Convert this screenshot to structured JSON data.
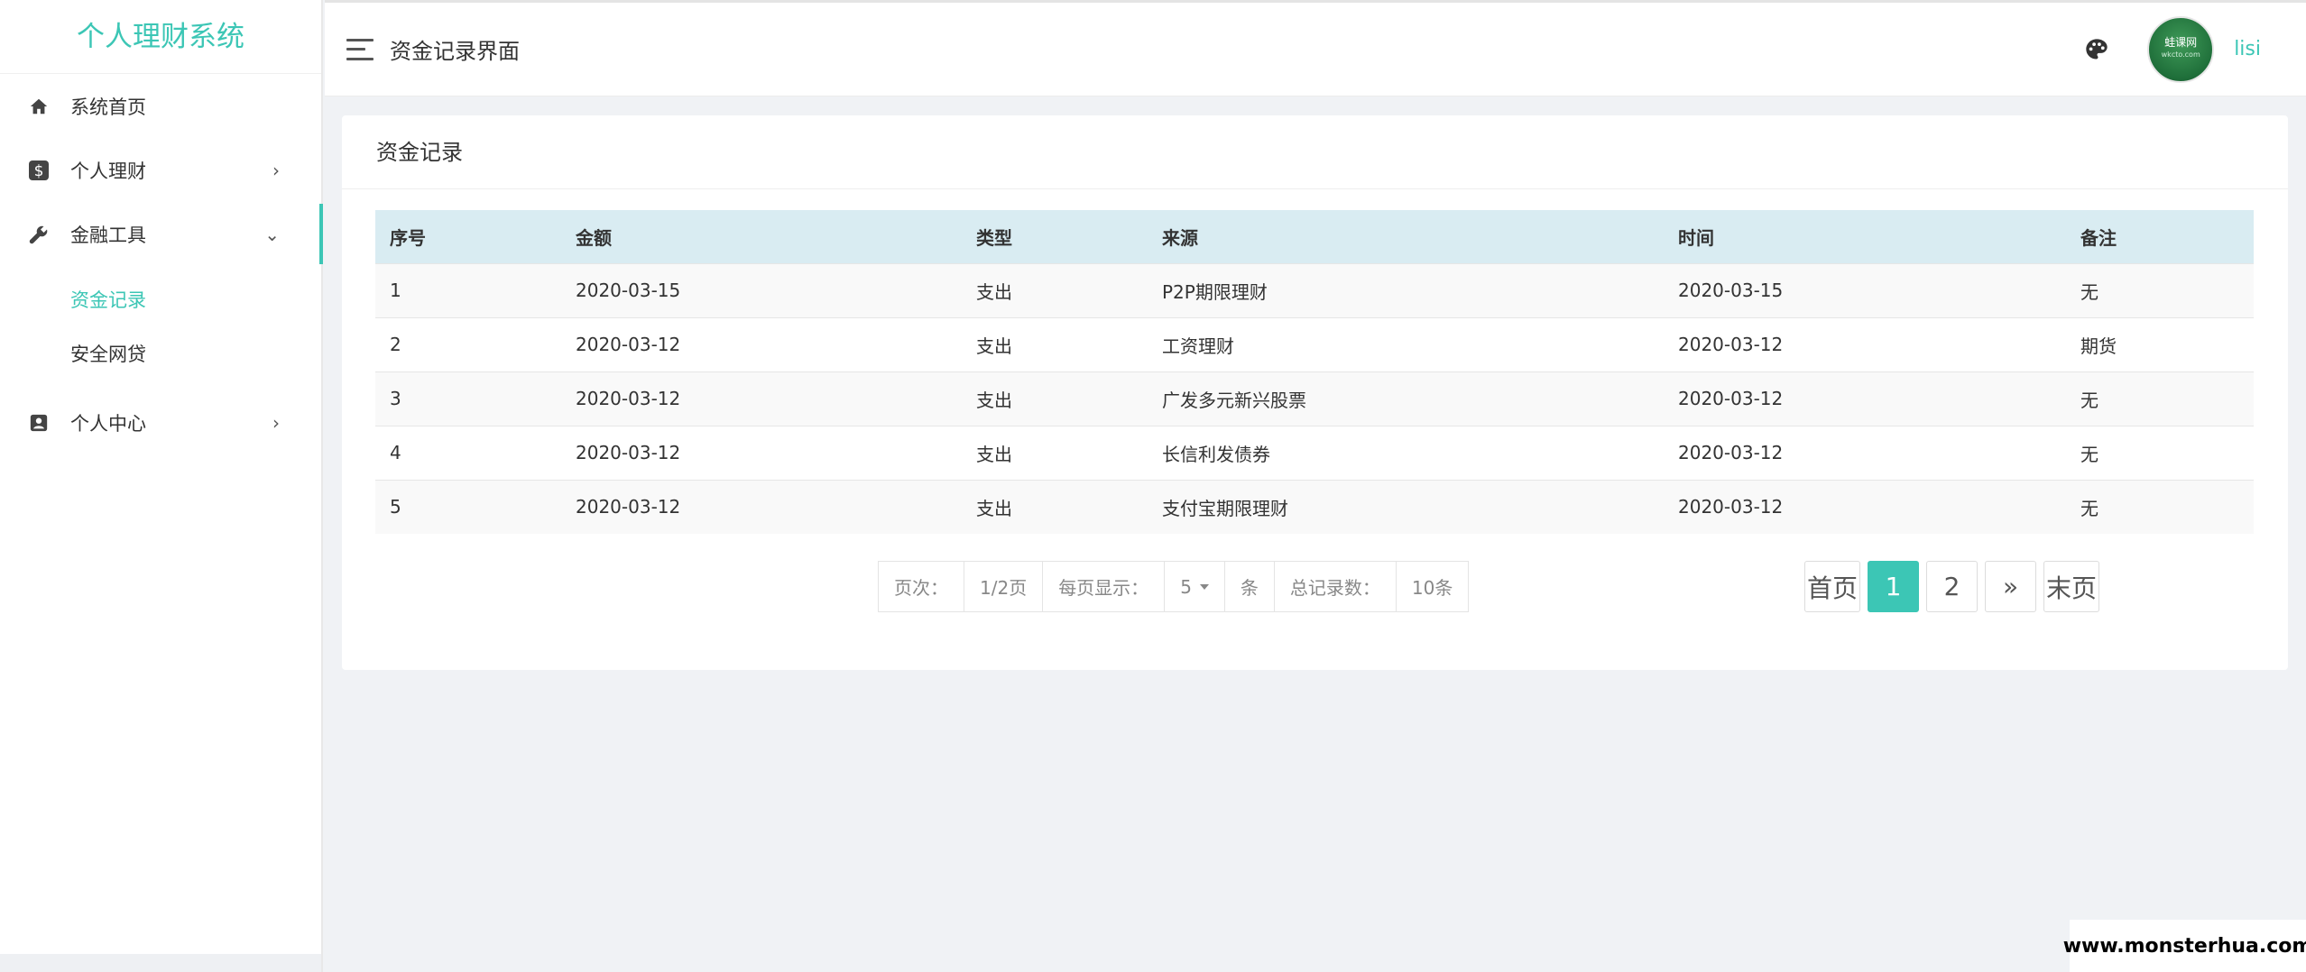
{
  "brand": {
    "title": "个人理财系统"
  },
  "sidebar": {
    "items": [
      {
        "label": "系统首页",
        "icon": "home-icon"
      },
      {
        "label": "个人理财",
        "icon": "dollar-icon",
        "arrow": "›"
      },
      {
        "label": "金融工具",
        "icon": "wrench-icon",
        "arrow": "⌄",
        "active": true,
        "children": [
          {
            "label": "资金记录",
            "active": true
          },
          {
            "label": "安全网贷"
          }
        ]
      },
      {
        "label": "个人中心",
        "icon": "user-card-icon",
        "arrow": "›"
      }
    ]
  },
  "header": {
    "page_title": "资金记录界面",
    "username": "lisi",
    "avatar_text": "蛙课网",
    "avatar_sub": "wkcto.com"
  },
  "card": {
    "title": "资金记录",
    "table": {
      "columns": [
        "序号",
        "金额",
        "类型",
        "来源",
        "时间",
        "备注"
      ],
      "rows": [
        [
          "1",
          "2020-03-15",
          "支出",
          "P2P期限理财",
          "2020-03-15",
          "无"
        ],
        [
          "2",
          "2020-03-12",
          "支出",
          "工资理财",
          "2020-03-12",
          "期货"
        ],
        [
          "3",
          "2020-03-12",
          "支出",
          "广发多元新兴股票",
          "2020-03-12",
          "无"
        ],
        [
          "4",
          "2020-03-12",
          "支出",
          "长信利发债券",
          "2020-03-12",
          "无"
        ],
        [
          "5",
          "2020-03-12",
          "支出",
          "支付宝期限理财",
          "2020-03-12",
          "无"
        ]
      ]
    },
    "info": {
      "page_label": "页次：",
      "page_value": "1/2页",
      "per_page_label": "每页显示：",
      "per_page_value": "5",
      "per_page_unit": "条",
      "total_label": "总记录数：",
      "total_value": "10条"
    },
    "pager": {
      "first": "首页",
      "pages": [
        "1",
        "2"
      ],
      "current": "1",
      "next": "»",
      "last": "末页"
    }
  },
  "watermark": "www.monsterhua.com",
  "colors": {
    "accent": "#3cc6b5",
    "table_header": "#d9ecf2"
  }
}
